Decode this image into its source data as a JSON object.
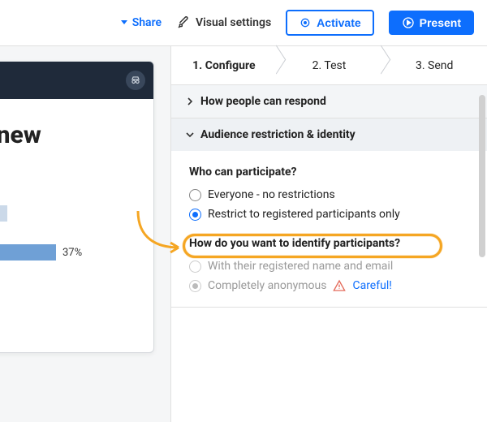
{
  "topbar": {
    "share": "Share",
    "visual_settings": "Visual settings",
    "activate": "Activate",
    "present": "Present"
  },
  "canvas": {
    "slide_title_fragment": "g new",
    "bar_percent": "37%"
  },
  "steps": {
    "s1": "1. Configure",
    "s2": "2. Test",
    "s3": "3. Send"
  },
  "accordion": {
    "how_respond": "How people can respond",
    "audience": "Audience restriction & identity"
  },
  "participate": {
    "question": "Who can participate?",
    "opt_everyone": "Everyone - no restrictions",
    "opt_restrict": "Restrict to registered participants only"
  },
  "identify": {
    "question": "How do you want to identify participants?",
    "opt_name_email": "With their registered name and email",
    "opt_anon": "Completely anonymous",
    "careful": "Careful!"
  }
}
